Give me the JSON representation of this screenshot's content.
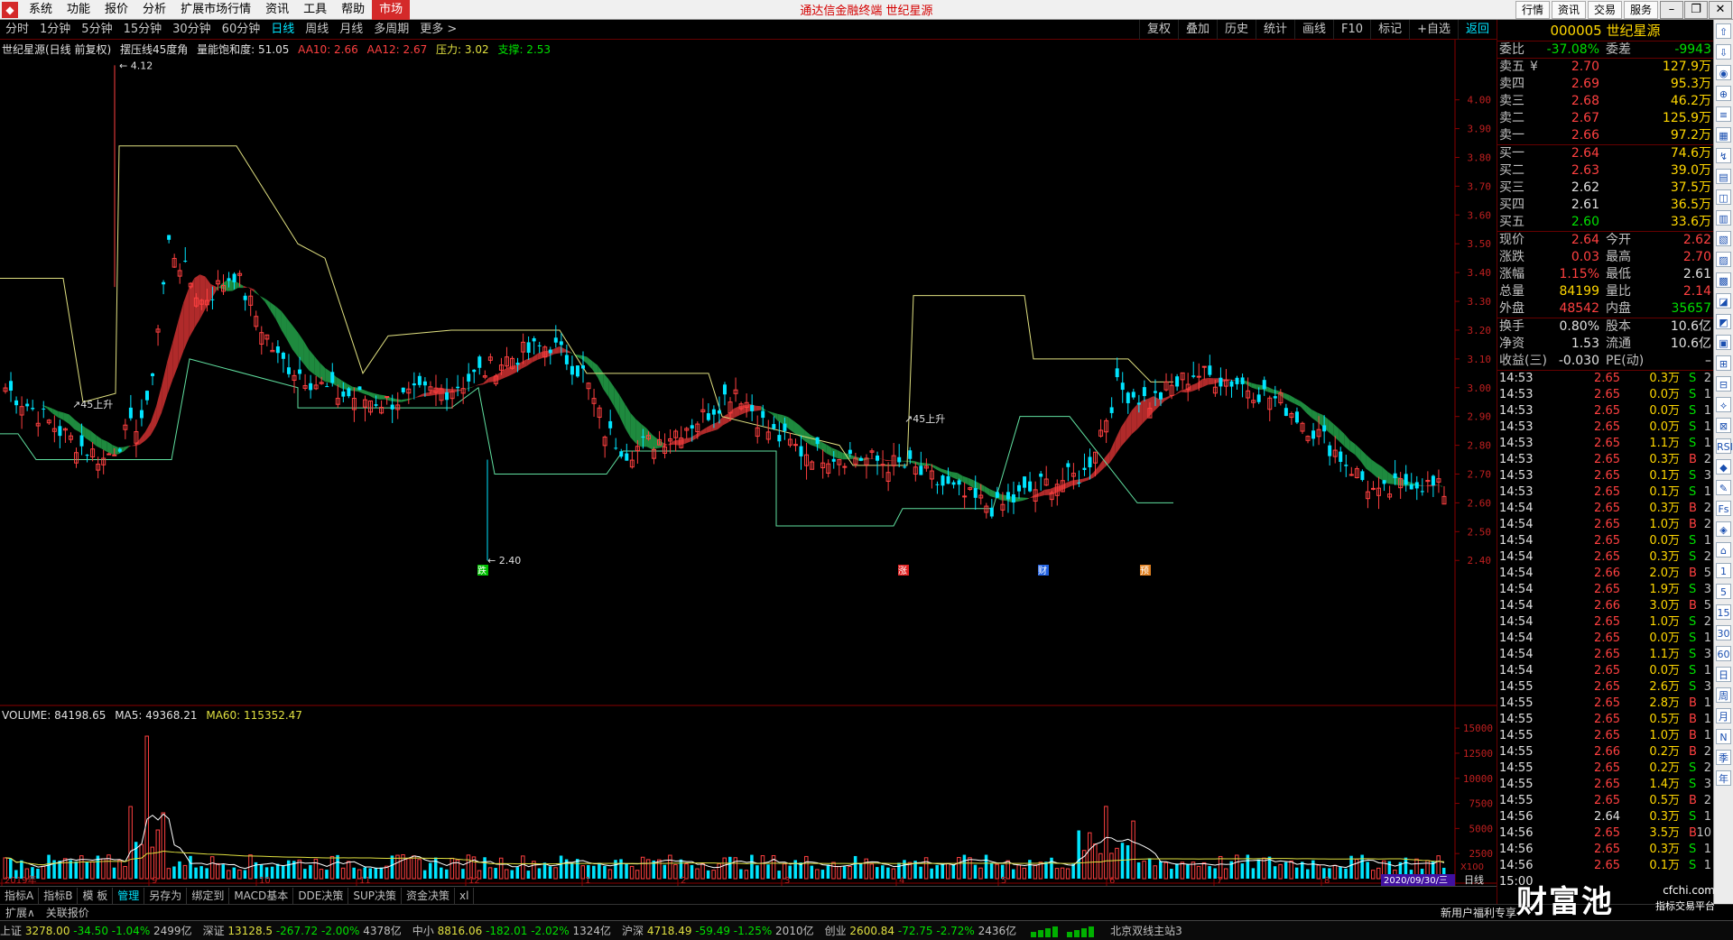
{
  "menubar": {
    "items": [
      "系统",
      "功能",
      "报价",
      "分析",
      "扩展市场行情",
      "资讯",
      "工具",
      "帮助",
      "市场"
    ],
    "center_title": "通达信金融终端  世纪星源",
    "right_buttons": [
      "行情",
      "资讯",
      "交易",
      "服务"
    ]
  },
  "period_bar": {
    "periods": [
      "分时",
      "1分钟",
      "5分钟",
      "15分钟",
      "30分钟",
      "60分钟",
      "日线",
      "周线",
      "月线",
      "多周期",
      "更多 >"
    ],
    "active": "日线",
    "right_tools": [
      "复权",
      "叠加",
      "历史",
      "统计",
      "画线",
      "F10",
      "标记",
      "+自选",
      "返回"
    ]
  },
  "main_chart": {
    "title": "世纪星源(日线 前复权)",
    "indicator_name": "摆压线45度角",
    "saturation_label": "量能饱和度: 51.05",
    "aa10": "AA10: 2.66",
    "aa12": "AA12: 2.67",
    "pressure": "压力: 3.02",
    "support": "支撑: 2.53",
    "high_mark": "4.12",
    "low_mark": "2.40",
    "rise_mark_1": "45上升",
    "rise_mark_2": "45上升",
    "event_marks": [
      "跌",
      "涨",
      "财",
      "预"
    ],
    "price_ticks": [
      "4.00",
      "3.90",
      "3.80",
      "3.70",
      "3.60",
      "3.50",
      "3.40",
      "3.30",
      "3.20",
      "3.10",
      "3.00",
      "2.90",
      "2.80",
      "2.70",
      "2.60",
      "2.50",
      "2.40"
    ]
  },
  "volume_chart": {
    "title": "VOLUME: 84198.65",
    "ma5": "MA5: 49368.21",
    "ma60": "MA60: 115352.47",
    "ticks": [
      "15000",
      "12500",
      "10000",
      "7500",
      "5000",
      "2500"
    ],
    "unit": "X100",
    "month_labels": [
      "2019年",
      "9",
      "10",
      "11",
      "12",
      "1",
      "2",
      "3",
      "4",
      "5",
      "6",
      "7",
      "8",
      "9"
    ],
    "current_date": "2020/09/30/三",
    "period_label": "日线"
  },
  "func_tabs": [
    "指标A",
    "指标B",
    "模 板",
    "管理",
    "另存为",
    "绑定到",
    "MACD基本",
    "DDE决策",
    "SUP决策",
    "资金决策",
    "xl"
  ],
  "func_tabs_active": "管理",
  "ext_bar": {
    "items": [
      "扩展∧",
      "关联报价"
    ],
    "promo": "新用户福利专享"
  },
  "quote": {
    "code": "000005",
    "name": "世纪星源",
    "weibi_label": "委比",
    "weibi": "-37.08%",
    "weicha_label": "委差",
    "weicha": "-9943",
    "asks": [
      {
        "label": "卖五",
        "price": "2.70",
        "vol": "127.9万",
        "flag": "¥"
      },
      {
        "label": "卖四",
        "price": "2.69",
        "vol": "95.3万",
        "flag": ""
      },
      {
        "label": "卖三",
        "price": "2.68",
        "vol": "46.2万",
        "flag": ""
      },
      {
        "label": "卖二",
        "price": "2.67",
        "vol": "125.9万",
        "flag": ""
      },
      {
        "label": "卖一",
        "price": "2.66",
        "vol": "97.2万",
        "flag": ""
      }
    ],
    "bids": [
      {
        "label": "买一",
        "price": "2.64",
        "vol": "74.6万"
      },
      {
        "label": "买二",
        "price": "2.63",
        "vol": "39.0万"
      },
      {
        "label": "买三",
        "price": "2.62",
        "vol": "37.5万"
      },
      {
        "label": "买四",
        "price": "2.61",
        "vol": "36.5万"
      },
      {
        "label": "买五",
        "price": "2.60",
        "vol": "33.6万"
      }
    ],
    "stats1": [
      {
        "l": "现价",
        "v": "2.64",
        "l2": "今开",
        "v2": "2.62",
        "c": "#ff4040",
        "c2": "#ff4040"
      },
      {
        "l": "涨跌",
        "v": "0.03",
        "l2": "最高",
        "v2": "2.70",
        "c": "#ff4040",
        "c2": "#ff4040"
      },
      {
        "l": "涨幅",
        "v": "1.15%",
        "l2": "最低",
        "v2": "2.61",
        "c": "#ff4040",
        "c2": "#e0e0e0"
      },
      {
        "l": "总量",
        "v": "84199",
        "l2": "量比",
        "v2": "2.14",
        "c": "#ffd700",
        "c2": "#ff4040"
      },
      {
        "l": "外盘",
        "v": "48542",
        "l2": "内盘",
        "v2": "35657",
        "c": "#ff4040",
        "c2": "#00e000"
      }
    ],
    "stats2": [
      {
        "l": "换手",
        "v": "0.80%",
        "l2": "股本",
        "v2": "10.6亿"
      },
      {
        "l": "净资",
        "v": "1.53",
        "l2": "流通",
        "v2": "10.6亿"
      },
      {
        "l": "收益(三)",
        "v": "-0.030",
        "l2": "PE(动)",
        "v2": "–"
      }
    ],
    "ticks": [
      {
        "t": "14:53",
        "p": "2.65",
        "v": "0.3万",
        "s": "S",
        "n": "2"
      },
      {
        "t": "14:53",
        "p": "2.65",
        "v": "0.0万",
        "s": "S",
        "n": "1"
      },
      {
        "t": "14:53",
        "p": "2.65",
        "v": "0.0万",
        "s": "S",
        "n": "1"
      },
      {
        "t": "14:53",
        "p": "2.65",
        "v": "0.0万",
        "s": "S",
        "n": "1"
      },
      {
        "t": "14:53",
        "p": "2.65",
        "v": "1.1万",
        "s": "S",
        "n": "1"
      },
      {
        "t": "14:53",
        "p": "2.65",
        "v": "0.3万",
        "s": "B",
        "n": "2"
      },
      {
        "t": "14:53",
        "p": "2.65",
        "v": "0.1万",
        "s": "S",
        "n": "3"
      },
      {
        "t": "14:53",
        "p": "2.65",
        "v": "0.1万",
        "s": "S",
        "n": "1"
      },
      {
        "t": "14:54",
        "p": "2.65",
        "v": "0.3万",
        "s": "B",
        "n": "2"
      },
      {
        "t": "14:54",
        "p": "2.65",
        "v": "1.0万",
        "s": "B",
        "n": "2"
      },
      {
        "t": "14:54",
        "p": "2.65",
        "v": "0.0万",
        "s": "S",
        "n": "1"
      },
      {
        "t": "14:54",
        "p": "2.65",
        "v": "0.3万",
        "s": "S",
        "n": "2"
      },
      {
        "t": "14:54",
        "p": "2.66",
        "v": "2.0万",
        "s": "B",
        "n": "5"
      },
      {
        "t": "14:54",
        "p": "2.65",
        "v": "1.9万",
        "s": "S",
        "n": "3"
      },
      {
        "t": "14:54",
        "p": "2.66",
        "v": "3.0万",
        "s": "B",
        "n": "5"
      },
      {
        "t": "14:54",
        "p": "2.65",
        "v": "1.0万",
        "s": "S",
        "n": "2"
      },
      {
        "t": "14:54",
        "p": "2.65",
        "v": "0.0万",
        "s": "S",
        "n": "1"
      },
      {
        "t": "14:54",
        "p": "2.65",
        "v": "1.1万",
        "s": "S",
        "n": "3"
      },
      {
        "t": "14:54",
        "p": "2.65",
        "v": "0.0万",
        "s": "S",
        "n": "1"
      },
      {
        "t": "14:55",
        "p": "2.65",
        "v": "2.6万",
        "s": "S",
        "n": "3"
      },
      {
        "t": "14:55",
        "p": "2.65",
        "v": "2.8万",
        "s": "B",
        "n": "1"
      },
      {
        "t": "14:55",
        "p": "2.65",
        "v": "0.5万",
        "s": "B",
        "n": "1"
      },
      {
        "t": "14:55",
        "p": "2.65",
        "v": "1.0万",
        "s": "B",
        "n": "1"
      },
      {
        "t": "14:55",
        "p": "2.66",
        "v": "0.2万",
        "s": "B",
        "n": "2"
      },
      {
        "t": "14:55",
        "p": "2.65",
        "v": "0.2万",
        "s": "S",
        "n": "2"
      },
      {
        "t": "14:55",
        "p": "2.65",
        "v": "1.4万",
        "s": "S",
        "n": "3"
      },
      {
        "t": "14:55",
        "p": "2.65",
        "v": "0.5万",
        "s": "B",
        "n": "2"
      },
      {
        "t": "14:56",
        "p": "2.64",
        "v": "0.3万",
        "s": "S",
        "n": "1"
      },
      {
        "t": "14:56",
        "p": "2.65",
        "v": "3.5万",
        "s": "B",
        "n": "10"
      },
      {
        "t": "14:56",
        "p": "2.65",
        "v": "0.3万",
        "s": "S",
        "n": "1"
      },
      {
        "t": "14:56",
        "p": "2.65",
        "v": "0.1万",
        "s": "S",
        "n": "1"
      },
      {
        "t": "15:00",
        "p": "",
        "v": "",
        "s": "",
        "n": ""
      }
    ]
  },
  "statusbar": {
    "indices": [
      {
        "n": "上证",
        "v": "3278.00",
        "d": "-34.50",
        "p": "-1.04%",
        "a": "2499亿"
      },
      {
        "n": "深证",
        "v": "13128.5",
        "d": "-267.72",
        "p": "-2.00%",
        "a": "4378亿"
      },
      {
        "n": "中小",
        "v": "8816.06",
        "d": "-182.01",
        "p": "-2.02%",
        "a": "1324亿"
      },
      {
        "n": "沪深",
        "v": "4718.49",
        "d": "-59.49",
        "p": "-1.25%",
        "a": "2010亿"
      },
      {
        "n": "创业",
        "v": "2600.84",
        "d": "-72.75",
        "p": "-2.72%",
        "a": "2436亿"
      }
    ],
    "server": "北京双线主站3"
  },
  "watermark": {
    "big": "财富池",
    "small": "cfchi.com",
    "small2": "指标交易平台"
  },
  "side_toolbar_icons": [
    "⇧",
    "⇩",
    "◉",
    "⊕",
    "≡",
    "▦",
    "↯",
    "▤",
    "◫",
    "▥",
    "▧",
    "▨",
    "▩",
    "◪",
    "◩",
    "▣",
    "⊞",
    "⊟",
    "⟡",
    "⊠",
    "RSI",
    "◆",
    "✎",
    "Fs",
    "◈",
    "⌂",
    "1",
    "5",
    "15",
    "30",
    "60",
    "日",
    "周",
    "月",
    "N",
    "季",
    "年"
  ],
  "colors": {
    "up": "#ff4040",
    "down": "#00e5ff",
    "pressure_line": "#e0e080",
    "support_line": "#60e0a0",
    "band_red": "#b02a2a",
    "band_green": "#1e8a3e",
    "ma5": "#ffffff",
    "ma60": "#e0e040"
  }
}
